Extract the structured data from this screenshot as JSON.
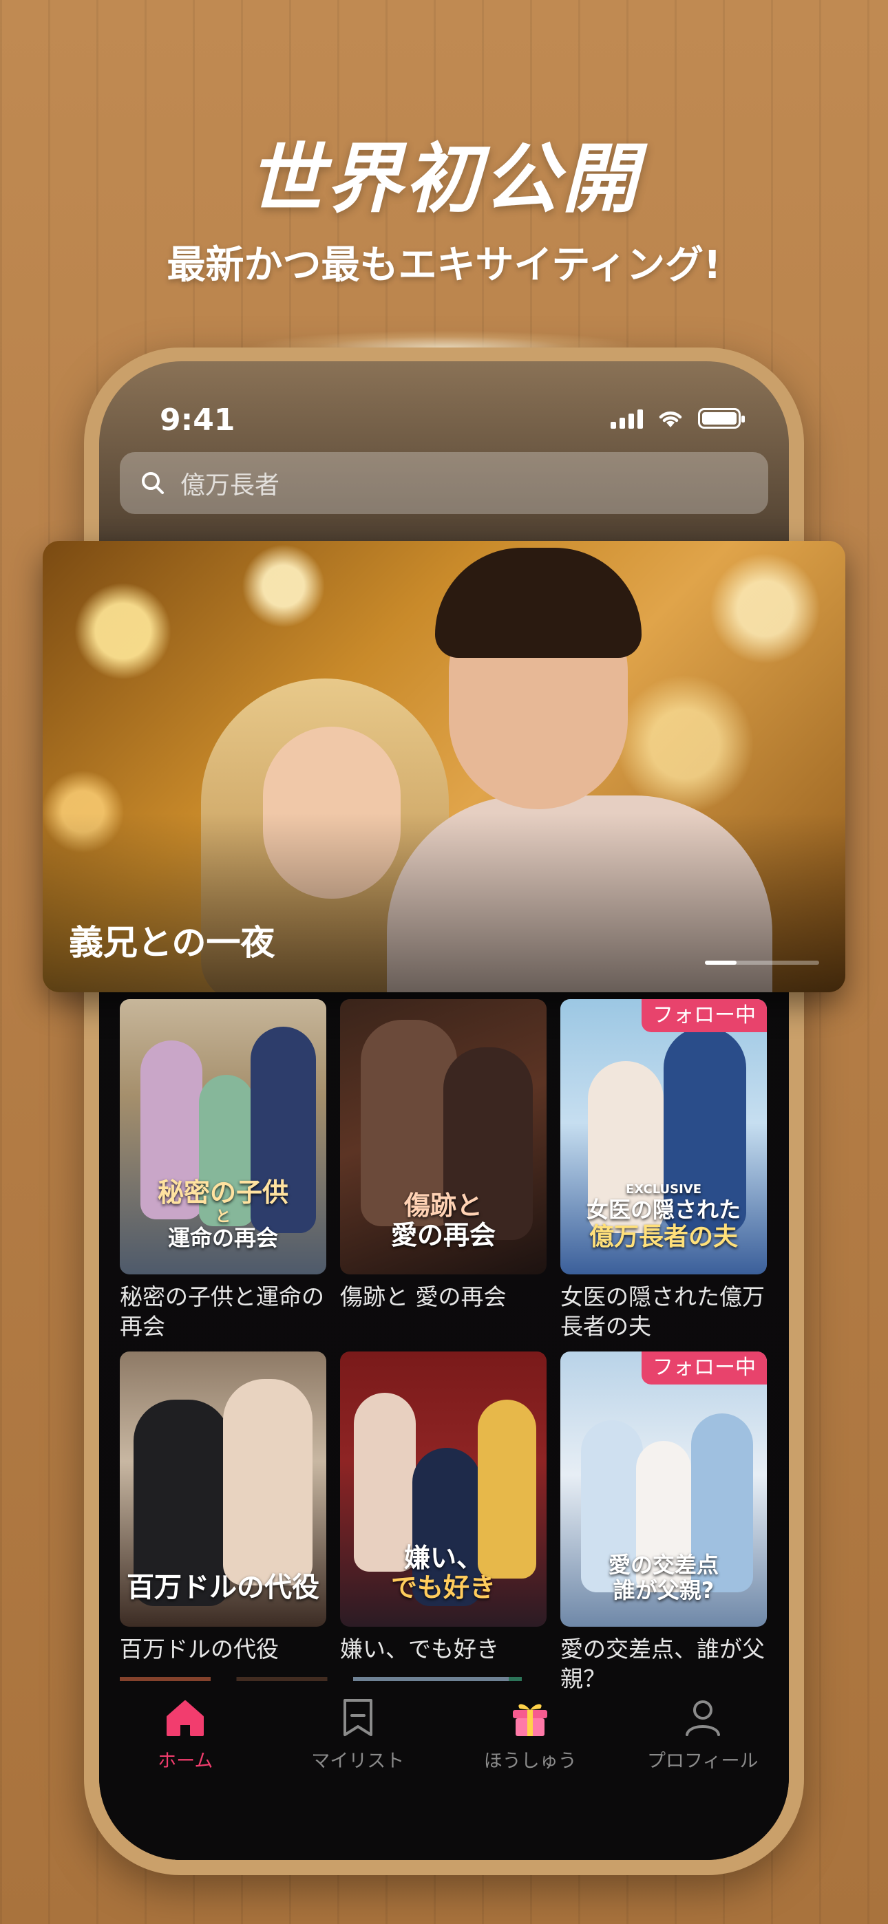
{
  "promo": {
    "headline": "世界初公開",
    "subline": "最新かつ最もエキサイティング!"
  },
  "status_bar": {
    "time": "9:41"
  },
  "search": {
    "placeholder": "億万長者"
  },
  "hero": {
    "title": "義兄との一夜"
  },
  "grid": [
    {
      "poster_caption_1": "秘密の子供",
      "poster_caption_2": "と",
      "poster_caption_3": "運命の再会",
      "label": "秘密の子供と運命の再会",
      "badge": ""
    },
    {
      "poster_caption_1": "傷跡と",
      "poster_caption_2": "愛の再会",
      "poster_caption_3": "",
      "label": "傷跡と 愛の再会",
      "badge": ""
    },
    {
      "poster_caption_1": "EXCLUSIVE",
      "poster_caption_2": "女医の隠された",
      "poster_caption_3": "億万長者の夫",
      "label": "女医の隠された億万長者の夫",
      "badge": "フォロー中"
    },
    {
      "poster_caption_1": "百万ドルの代役",
      "poster_caption_2": "",
      "poster_caption_3": "",
      "label": "百万ドルの代役",
      "badge": ""
    },
    {
      "poster_caption_1": "嫌い、",
      "poster_caption_2": "でも好き",
      "poster_caption_3": "",
      "label": "嫌い、でも好き",
      "badge": ""
    },
    {
      "poster_caption_1": "愛の交差点",
      "poster_caption_2": "誰が父親?",
      "poster_caption_3": "",
      "label": "愛の交差点、誰が父親？",
      "badge": "フォロー中"
    }
  ],
  "tabbar": {
    "items": [
      {
        "label": "ホーム",
        "icon": "home-icon",
        "active": true
      },
      {
        "label": "マイリスト",
        "icon": "bookmark-icon",
        "active": false
      },
      {
        "label": "ほうしゅう",
        "icon": "gift-icon",
        "active": false
      },
      {
        "label": "プロフィール",
        "icon": "profile-icon",
        "active": false
      }
    ]
  },
  "colors": {
    "accent": "#f23d6e",
    "badge": "#e8436c",
    "background": "#b47d46",
    "phone_frame": "#caa06a"
  }
}
